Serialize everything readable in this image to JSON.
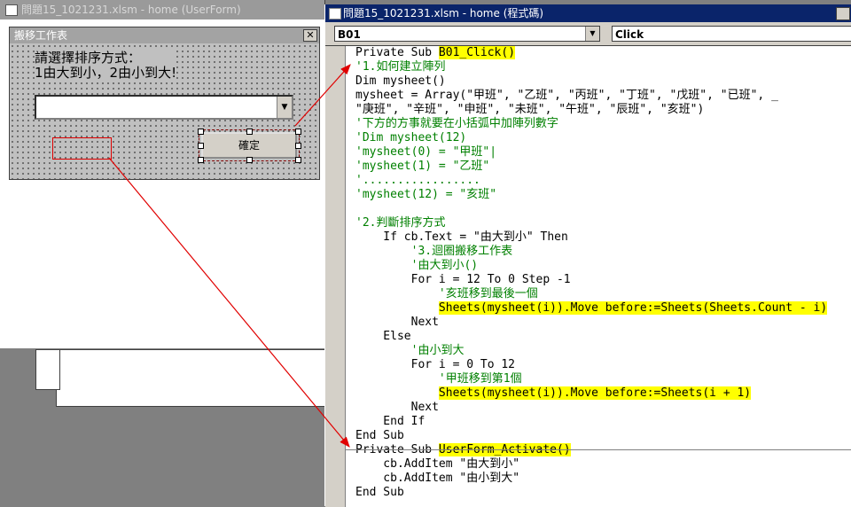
{
  "left_window": {
    "title": "問題15_1021231.xlsm - home (UserForm)",
    "form": {
      "caption": "搬移工作表",
      "close_label": "✕",
      "label_line1": "請選擇排序方式：",
      "label_line2": "1由大到小，2由小到大!",
      "combo_value": "",
      "combo_arrow": "▼",
      "button_label": "確定"
    }
  },
  "code_window": {
    "title": "問題15_1021231.xlsm - home (程式碼)",
    "object_dropdown": "B01",
    "procedure_dropdown": "Click",
    "dropdown_arrow": "▼",
    "lines": [
      {
        "segments": [
          {
            "text": "Private Sub ",
            "cls": ""
          },
          {
            "text": "B01_Click()",
            "cls": "hl"
          }
        ]
      },
      {
        "segments": [
          {
            "text": "'1.如何建立陣列",
            "cls": "cmt"
          }
        ]
      },
      {
        "segments": [
          {
            "text": "Dim mysheet()",
            "cls": ""
          }
        ]
      },
      {
        "segments": [
          {
            "text": "mysheet = Array(\"甲班\", \"乙班\", \"丙班\", \"丁班\", \"戊班\", \"已班\", _",
            "cls": ""
          }
        ]
      },
      {
        "segments": [
          {
            "text": "\"庚班\", \"辛班\", \"申班\", \"未班\", \"午班\", \"辰班\", \"亥班\")",
            "cls": ""
          }
        ]
      },
      {
        "segments": [
          {
            "text": "'下方的方事就要在小括弧中加陣列數字",
            "cls": "cmt"
          }
        ]
      },
      {
        "segments": [
          {
            "text": "'Dim mysheet(12)",
            "cls": "cmt"
          }
        ]
      },
      {
        "segments": [
          {
            "text": "'mysheet(0) = \"甲班\"|",
            "cls": "cmt"
          }
        ]
      },
      {
        "segments": [
          {
            "text": "'mysheet(1) = \"乙班\"",
            "cls": "cmt"
          }
        ]
      },
      {
        "segments": [
          {
            "text": "'.................",
            "cls": "cmt"
          }
        ]
      },
      {
        "segments": [
          {
            "text": "'mysheet(12) = \"亥班\"",
            "cls": "cmt"
          }
        ]
      },
      {
        "segments": [
          {
            "text": "",
            "cls": ""
          }
        ]
      },
      {
        "segments": [
          {
            "text": "'2.判斷排序方式",
            "cls": "cmt"
          }
        ]
      },
      {
        "segments": [
          {
            "text": "    If cb.Text = \"由大到小\" Then",
            "cls": ""
          }
        ]
      },
      {
        "segments": [
          {
            "text": "        '3.迴圈搬移工作表",
            "cls": "cmt"
          }
        ]
      },
      {
        "segments": [
          {
            "text": "        '由大到小()",
            "cls": "cmt"
          }
        ]
      },
      {
        "segments": [
          {
            "text": "        For i = 12 To 0 Step -1",
            "cls": ""
          }
        ]
      },
      {
        "segments": [
          {
            "text": "            '亥班移到最後一個",
            "cls": "cmt"
          }
        ]
      },
      {
        "segments": [
          {
            "text": "            ",
            "cls": ""
          },
          {
            "text": "Sheets(mysheet(i)).Move before:=Sheets(Sheets.Count - i)",
            "cls": "hl"
          }
        ]
      },
      {
        "segments": [
          {
            "text": "        Next",
            "cls": ""
          }
        ]
      },
      {
        "segments": [
          {
            "text": "    Else",
            "cls": ""
          }
        ]
      },
      {
        "segments": [
          {
            "text": "        '由小到大",
            "cls": "cmt"
          }
        ]
      },
      {
        "segments": [
          {
            "text": "        For i = 0 To 12",
            "cls": ""
          }
        ]
      },
      {
        "segments": [
          {
            "text": "            '甲班移到第1個",
            "cls": "cmt"
          }
        ]
      },
      {
        "segments": [
          {
            "text": "            ",
            "cls": ""
          },
          {
            "text": "Sheets(mysheet(i)).Move before:=Sheets(i + 1)",
            "cls": "hl"
          }
        ]
      },
      {
        "segments": [
          {
            "text": "        Next",
            "cls": ""
          }
        ]
      },
      {
        "segments": [
          {
            "text": "    End If",
            "cls": ""
          }
        ]
      },
      {
        "segments": [
          {
            "text": "End Sub",
            "cls": ""
          }
        ]
      },
      {
        "segments": [
          {
            "text": "Private Sub ",
            "cls": ""
          },
          {
            "text": "UserForm_Activate()",
            "cls": "hl"
          }
        ]
      },
      {
        "segments": [
          {
            "text": "    cb.AddItem \"由大到小\"",
            "cls": ""
          }
        ]
      },
      {
        "segments": [
          {
            "text": "    cb.AddItem \"由小到大\"",
            "cls": ""
          }
        ]
      },
      {
        "segments": [
          {
            "text": "End Sub",
            "cls": ""
          }
        ]
      }
    ]
  },
  "colors": {
    "highlight": "#ffff00",
    "comment": "#008000",
    "annotation_arrow": "#e00000",
    "title_bar_active": "#0a246a"
  }
}
